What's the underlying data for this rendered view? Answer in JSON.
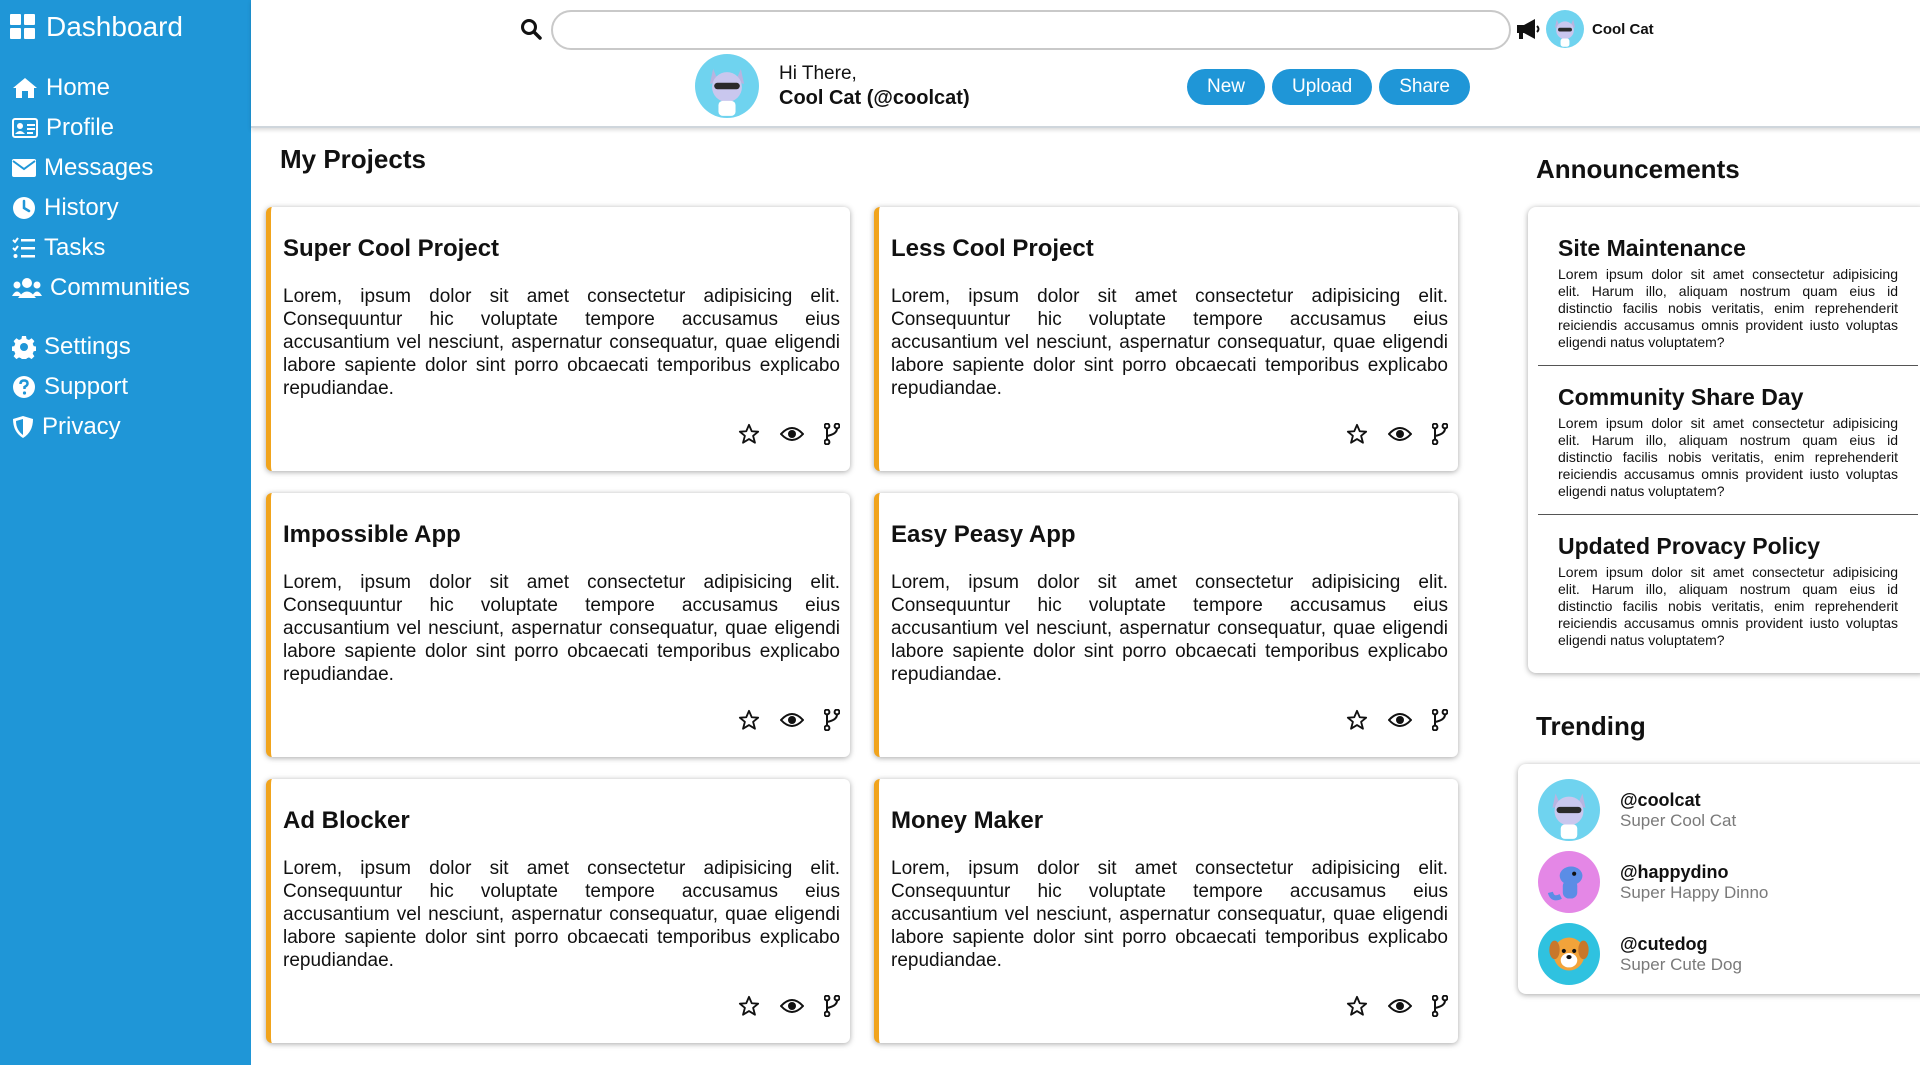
{
  "sidebar": {
    "brand": "Dashboard",
    "items": [
      {
        "label": "Home",
        "icon": "home-icon"
      },
      {
        "label": "Profile",
        "icon": "id-card-icon"
      },
      {
        "label": "Messages",
        "icon": "envelope-icon"
      },
      {
        "label": "History",
        "icon": "clock-icon"
      },
      {
        "label": "Tasks",
        "icon": "list-check-icon"
      },
      {
        "label": "Communities",
        "icon": "users-icon"
      }
    ],
    "secondary": [
      {
        "label": "Settings",
        "icon": "gear-icon"
      },
      {
        "label": "Support",
        "icon": "question-circle-icon"
      },
      {
        "label": "Privacy",
        "icon": "shield-icon"
      }
    ]
  },
  "header": {
    "search_value": "",
    "user_name": "Cool Cat",
    "greeting_line1": "Hi There,",
    "greeting_line2": "Cool Cat (@coolcat)",
    "buttons": {
      "new": "New",
      "upload": "Upload",
      "share": "Share"
    }
  },
  "projects": {
    "title": "My Projects",
    "items": [
      {
        "title": "Super Cool Project",
        "body": "Lorem, ipsum dolor sit amet consectetur adipisicing elit. Consequuntur hic voluptate tempore accusamus eius accusantium vel nesciunt, aspernatur consequatur, quae eligendi labore sapiente dolor sint porro obcaecati temporibus explicabo repudiandae."
      },
      {
        "title": "Less Cool Project",
        "body": "Lorem, ipsum dolor sit amet consectetur adipisicing elit. Consequuntur hic voluptate tempore accusamus eius accusantium vel nesciunt, aspernatur consequatur, quae eligendi labore sapiente dolor sint porro obcaecati temporibus explicabo repudiandae."
      },
      {
        "title": "Impossible App",
        "body": "Lorem, ipsum dolor sit amet consectetur adipisicing elit. Consequuntur hic voluptate tempore accusamus eius accusantium vel nesciunt, aspernatur consequatur, quae eligendi labore sapiente dolor sint porro obcaecati temporibus explicabo repudiandae."
      },
      {
        "title": "Easy Peasy App",
        "body": "Lorem, ipsum dolor sit amet consectetur adipisicing elit. Consequuntur hic voluptate tempore accusamus eius accusantium vel nesciunt, aspernatur consequatur, quae eligendi labore sapiente dolor sint porro obcaecati temporibus explicabo repudiandae."
      },
      {
        "title": "Ad Blocker",
        "body": "Lorem, ipsum dolor sit amet consectetur adipisicing elit. Consequuntur hic voluptate tempore accusamus eius accusantium vel nesciunt, aspernatur consequatur, quae eligendi labore sapiente dolor sint porro obcaecati temporibus explicabo repudiandae."
      },
      {
        "title": "Money Maker",
        "body": "Lorem, ipsum dolor sit amet consectetur adipisicing elit. Consequuntur hic voluptate tempore accusamus eius accusantium vel nesciunt, aspernatur consequatur, quae eligendi labore sapiente dolor sint porro obcaecati temporibus explicabo repudiandae."
      }
    ]
  },
  "announcements": {
    "title": "Announcements",
    "items": [
      {
        "title": "Site Maintenance",
        "body": "Lorem ipsum dolor sit amet consectetur adipisicing elit. Harum illo, aliquam nostrum quam eius id distinctio facilis nobis veritatis, enim reprehenderit reiciendis accusamus omnis provident iusto voluptas eligendi natus voluptatem?"
      },
      {
        "title": "Community Share Day",
        "body": "Lorem ipsum dolor sit amet consectetur adipisicing elit. Harum illo, aliquam nostrum quam eius id distinctio facilis nobis veritatis, enim reprehenderit reiciendis accusamus omnis provident iusto voluptas eligendi natus voluptatem?"
      },
      {
        "title": "Updated Provacy Policy",
        "body": "Lorem ipsum dolor sit amet consectetur adipisicing elit. Harum illo, aliquam nostrum quam eius id distinctio facilis nobis veritatis, enim reprehenderit reiciendis accusamus omnis provident iusto voluptas eligendi natus voluptatem?"
      }
    ]
  },
  "trending": {
    "title": "Trending",
    "items": [
      {
        "handle": "@coolcat",
        "name": "Super Cool Cat",
        "avatar_bg": "#6fd3ef"
      },
      {
        "handle": "@happydino",
        "name": "Super Happy Dinno",
        "avatar_bg": "#e487e6"
      },
      {
        "handle": "@cutedog",
        "name": "Super Cute Dog",
        "avatar_bg": "#2fc2e0"
      }
    ]
  },
  "colors": {
    "sidebar": "#1f96d7",
    "accent": "#f1a41d",
    "button": "#1f96d7"
  }
}
